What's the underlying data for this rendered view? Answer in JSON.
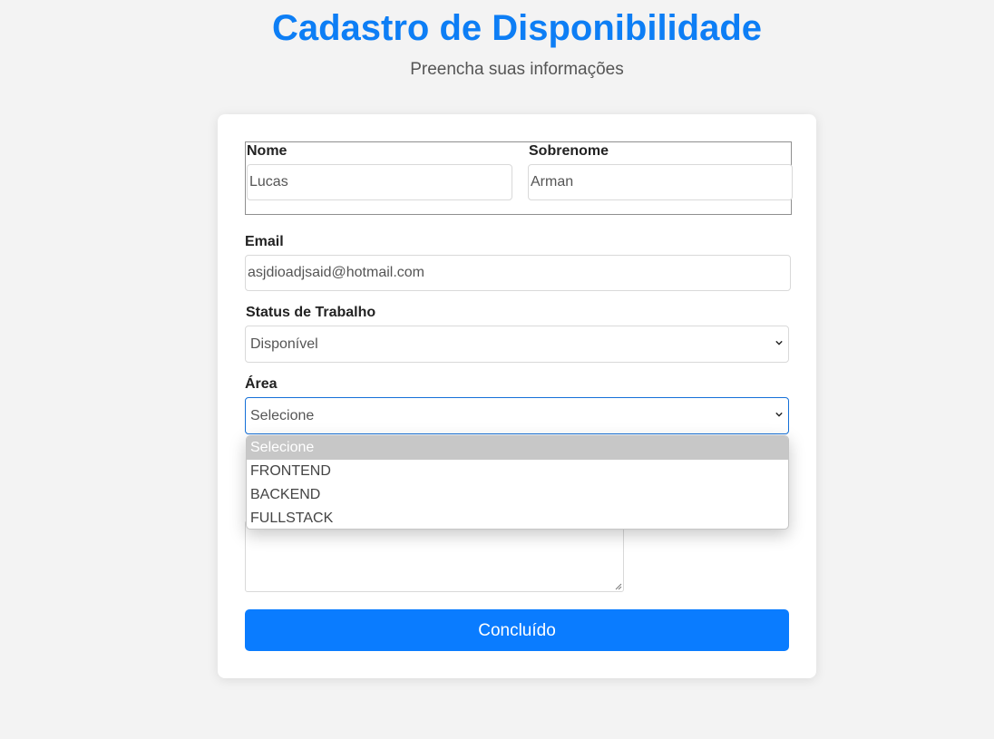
{
  "header": {
    "title": "Cadastro de Disponibilidade",
    "subtitle": "Preencha suas informações"
  },
  "form": {
    "name": {
      "label": "Nome",
      "value": "Lucas"
    },
    "surname": {
      "label": "Sobrenome",
      "value": "Arman"
    },
    "email": {
      "label": "Email",
      "value": "asjdioadjsaid@hotmail.com"
    },
    "work_status": {
      "label": "Status de Trabalho",
      "value": "Disponível"
    },
    "area": {
      "label": "Área",
      "value": "Selecione",
      "options": [
        "Selecione",
        "FRONTEND",
        "BACKEND",
        "FULLSTACK"
      ]
    },
    "submit_label": "Concluído"
  },
  "colors": {
    "accent": "#0a7cff",
    "title": "#0d7ef5",
    "background": "#f3f3f3"
  },
  "icons": [
    "chevron-down-icon",
    "resize-grip-icon"
  ]
}
